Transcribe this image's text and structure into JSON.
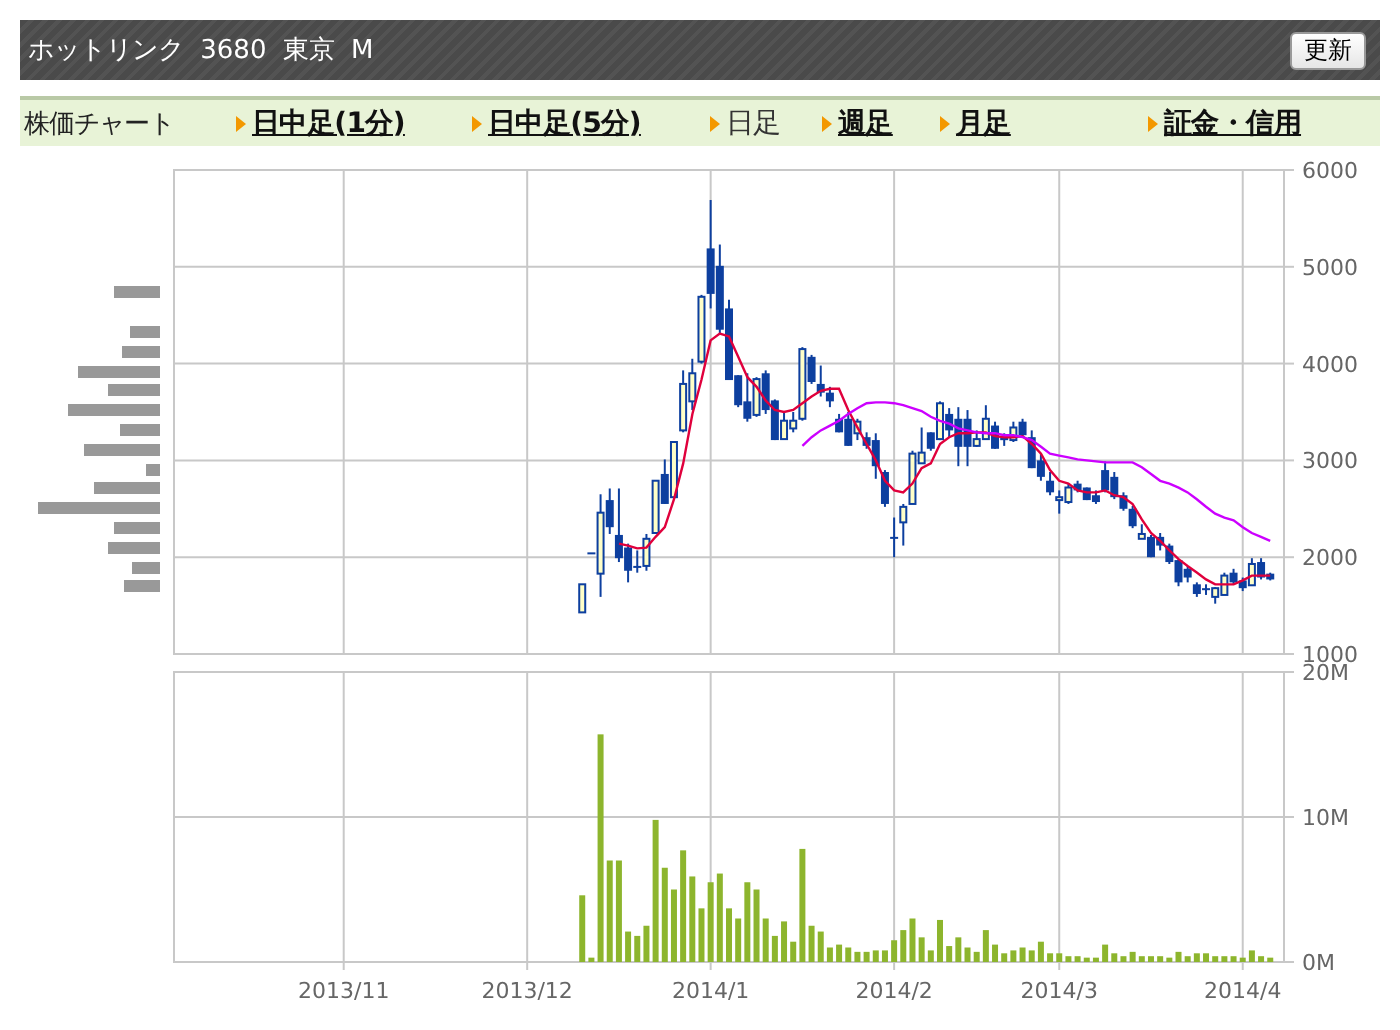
{
  "header": {
    "title": "ホットリンク 3680 東京 M",
    "refresh_button": "更新"
  },
  "nav": {
    "label": "株価チャート",
    "tabs": [
      {
        "label": "日中足(1分)",
        "selected": false
      },
      {
        "label": "日中足(5分)",
        "selected": false
      },
      {
        "label": "日足",
        "selected": true
      },
      {
        "label": "週足",
        "selected": false
      },
      {
        "label": "月足",
        "selected": false
      },
      {
        "label": "証金・信用",
        "selected": false
      }
    ]
  },
  "price_chart": {
    "chart_data": {
      "type": "candlestick",
      "grid": true,
      "ylim": [
        1000,
        6000
      ],
      "yticks": [
        {
          "value": 1000,
          "label": "1000"
        },
        {
          "value": 2000,
          "label": "2000"
        },
        {
          "value": 3000,
          "label": "3000"
        },
        {
          "value": 4000,
          "label": "4000"
        },
        {
          "value": 5000,
          "label": "5000"
        },
        {
          "value": 6000,
          "label": "6000"
        }
      ],
      "ohlc": [
        null,
        null,
        null,
        null,
        null,
        null,
        null,
        null,
        null,
        null,
        null,
        null,
        null,
        null,
        null,
        null,
        null,
        null,
        null,
        null,
        null,
        null,
        null,
        null,
        null,
        null,
        null,
        null,
        null,
        null,
        null,
        null,
        null,
        null,
        null,
        null,
        null,
        null,
        null,
        null,
        null,
        null,
        null,
        null,
        [
          1430,
          1720,
          1430,
          1720
        ],
        [
          2050,
          2050,
          2050,
          2050
        ],
        [
          1830,
          2650,
          1590,
          2460
        ],
        [
          2590,
          2710,
          2240,
          2310
        ],
        [
          2230,
          2710,
          1950,
          1990
        ],
        [
          2100,
          2140,
          1740,
          1860
        ],
        [
          1910,
          2070,
          1840,
          1910
        ],
        [
          1910,
          2240,
          1860,
          2190
        ],
        [
          2250,
          2790,
          2250,
          2790
        ],
        [
          2860,
          3010,
          2550,
          2550
        ],
        [
          2620,
          3190,
          2620,
          3190
        ],
        [
          3310,
          3930,
          3290,
          3790
        ],
        [
          3610,
          4050,
          3520,
          3900
        ],
        [
          4020,
          4710,
          4000,
          4690
        ],
        [
          5190,
          5690,
          4570,
          4720
        ],
        [
          5010,
          5230,
          4310,
          4350
        ],
        [
          4570,
          4660,
          3830,
          3830
        ],
        [
          3880,
          3880,
          3550,
          3570
        ],
        [
          3610,
          3900,
          3400,
          3430
        ],
        [
          3470,
          3860,
          3450,
          3840
        ],
        [
          3900,
          3930,
          3480,
          3520
        ],
        [
          3620,
          3630,
          3210,
          3210
        ],
        [
          3220,
          3500,
          3220,
          3410
        ],
        [
          3330,
          3500,
          3290,
          3410
        ],
        [
          3430,
          4170,
          3410,
          4150
        ],
        [
          4070,
          4090,
          3790,
          3810
        ],
        [
          3790,
          3980,
          3660,
          3700
        ],
        [
          3700,
          3760,
          3550,
          3610
        ],
        [
          3430,
          3480,
          3290,
          3290
        ],
        [
          3430,
          3500,
          3150,
          3150
        ],
        [
          3280,
          3430,
          3210,
          3400
        ],
        [
          3240,
          3290,
          3120,
          3150
        ],
        [
          3210,
          3280,
          2810,
          2940
        ],
        [
          2880,
          2900,
          2520,
          2550
        ],
        [
          2210,
          2410,
          2000,
          2210
        ],
        [
          2360,
          2550,
          2120,
          2520
        ],
        [
          2550,
          3100,
          2550,
          3070
        ],
        [
          2970,
          3340,
          2970,
          3080
        ],
        [
          3290,
          3290,
          3100,
          3120
        ],
        [
          3220,
          3610,
          3210,
          3590
        ],
        [
          3480,
          3540,
          3240,
          3310
        ],
        [
          3430,
          3550,
          2940,
          3140
        ],
        [
          3430,
          3520,
          2940,
          3140
        ],
        [
          3150,
          3310,
          3140,
          3220
        ],
        [
          3220,
          3570,
          3220,
          3430
        ],
        [
          3360,
          3400,
          3120,
          3120
        ],
        [
          3220,
          3280,
          3150,
          3240
        ],
        [
          3210,
          3400,
          3190,
          3340
        ],
        [
          3400,
          3430,
          3240,
          3260
        ],
        [
          3240,
          3310,
          2920,
          2920
        ],
        [
          3000,
          3070,
          2790,
          2830
        ],
        [
          2790,
          2880,
          2640,
          2670
        ],
        [
          2590,
          2690,
          2450,
          2620
        ],
        [
          2570,
          2760,
          2550,
          2720
        ],
        [
          2760,
          2790,
          2670,
          2690
        ],
        [
          2720,
          2720,
          2590,
          2590
        ],
        [
          2640,
          2690,
          2550,
          2570
        ],
        [
          2900,
          2990,
          2670,
          2690
        ],
        [
          2830,
          2880,
          2600,
          2620
        ],
        [
          2640,
          2670,
          2480,
          2500
        ],
        [
          2500,
          2530,
          2300,
          2320
        ],
        [
          2190,
          2340,
          2190,
          2240
        ],
        [
          2210,
          2230,
          2000,
          2000
        ],
        [
          2210,
          2250,
          2070,
          2120
        ],
        [
          2120,
          2140,
          1930,
          1950
        ],
        [
          1970,
          1980,
          1700,
          1740
        ],
        [
          1880,
          1910,
          1740,
          1790
        ],
        [
          1720,
          1740,
          1590,
          1620
        ],
        [
          1680,
          1720,
          1610,
          1680
        ],
        [
          1590,
          1690,
          1520,
          1680
        ],
        [
          1610,
          1840,
          1610,
          1810
        ],
        [
          1840,
          1880,
          1720,
          1740
        ],
        [
          1760,
          1790,
          1650,
          1680
        ],
        [
          1710,
          1990,
          1710,
          1930
        ],
        [
          1950,
          1990,
          1770,
          1790
        ],
        [
          1830,
          1840,
          1760,
          1770
        ],
        null
      ],
      "series": [
        {
          "type": "line",
          "color": "#e0003c",
          "values": [
            null,
            null,
            null,
            null,
            null,
            null,
            null,
            null,
            null,
            null,
            null,
            null,
            null,
            null,
            null,
            null,
            null,
            null,
            null,
            null,
            null,
            null,
            null,
            null,
            null,
            null,
            null,
            null,
            null,
            null,
            null,
            null,
            null,
            null,
            null,
            null,
            null,
            null,
            null,
            null,
            null,
            null,
            null,
            null,
            null,
            null,
            null,
            null,
            2140,
            2120,
            2090,
            2100,
            2210,
            2310,
            2600,
            2970,
            3480,
            3830,
            4240,
            4310,
            4280,
            4070,
            3860,
            3760,
            3620,
            3520,
            3500,
            3520,
            3590,
            3660,
            3720,
            3740,
            3740,
            3520,
            3340,
            3170,
            3000,
            2790,
            2690,
            2670,
            2760,
            2920,
            2970,
            3170,
            3240,
            3280,
            3280,
            3290,
            3290,
            3250,
            3240,
            3240,
            3250,
            3170,
            3070,
            2900,
            2790,
            2760,
            2690,
            2670,
            2670,
            2690,
            2640,
            2620,
            2550,
            2390,
            2250,
            2170,
            2070,
            1980,
            1910,
            1840,
            1770,
            1720,
            1720,
            1720,
            1760,
            1810,
            1810,
            1810,
            null
          ]
        },
        {
          "type": "line",
          "color": "#cc00ff",
          "values": [
            null,
            null,
            null,
            null,
            null,
            null,
            null,
            null,
            null,
            null,
            null,
            null,
            null,
            null,
            null,
            null,
            null,
            null,
            null,
            null,
            null,
            null,
            null,
            null,
            null,
            null,
            null,
            null,
            null,
            null,
            null,
            null,
            null,
            null,
            null,
            null,
            null,
            null,
            null,
            null,
            null,
            null,
            null,
            null,
            null,
            null,
            null,
            null,
            null,
            null,
            null,
            null,
            null,
            null,
            null,
            null,
            null,
            null,
            null,
            null,
            null,
            null,
            null,
            null,
            null,
            null,
            null,
            null,
            3150,
            3240,
            3310,
            3360,
            3410,
            3480,
            3540,
            3590,
            3600,
            3600,
            3590,
            3570,
            3540,
            3510,
            3450,
            3410,
            3380,
            3330,
            3310,
            3290,
            3280,
            3280,
            3260,
            3260,
            3240,
            3210,
            3140,
            3070,
            3050,
            3030,
            3010,
            3000,
            2990,
            2980,
            2980,
            2980,
            2980,
            2930,
            2860,
            2790,
            2760,
            2720,
            2670,
            2600,
            2520,
            2450,
            2410,
            2380,
            2310,
            2250,
            2210,
            2170,
            null
          ]
        }
      ]
    }
  },
  "volume_chart": {
    "chart_data": {
      "type": "bar",
      "grid": true,
      "ylim": [
        0,
        20
      ],
      "categories": [
        null,
        null,
        null,
        null,
        null,
        null,
        null,
        null,
        null,
        null,
        null,
        null,
        null,
        null,
        null,
        null,
        null,
        null,
        "2013/11",
        null,
        null,
        null,
        null,
        null,
        null,
        null,
        null,
        null,
        null,
        null,
        null,
        null,
        null,
        null,
        null,
        null,
        null,
        null,
        "2013/12",
        null,
        null,
        null,
        null,
        null,
        null,
        null,
        null,
        null,
        null,
        null,
        null,
        null,
        null,
        null,
        null,
        null,
        null,
        null,
        "2014/1",
        null,
        null,
        null,
        null,
        null,
        null,
        null,
        null,
        null,
        null,
        null,
        null,
        null,
        null,
        null,
        null,
        null,
        null,
        null,
        "2014/2",
        null,
        null,
        null,
        null,
        null,
        null,
        null,
        null,
        null,
        null,
        null,
        null,
        null,
        null,
        null,
        null,
        null,
        "2014/3",
        null,
        null,
        null,
        null,
        null,
        null,
        null,
        null,
        null,
        null,
        null,
        null,
        null,
        null,
        null,
        null,
        null,
        null,
        null,
        "2014/4",
        null,
        null,
        null,
        null
      ],
      "yticks": [
        {
          "value": 0,
          "label": "0M"
        },
        {
          "value": 10,
          "label": "10M"
        },
        {
          "value": 20,
          "label": "20M"
        }
      ],
      "series": [
        {
          "color": "#8db52d",
          "values": [
            null,
            null,
            null,
            null,
            null,
            null,
            null,
            null,
            null,
            null,
            null,
            null,
            null,
            null,
            null,
            null,
            null,
            null,
            null,
            null,
            null,
            null,
            null,
            null,
            null,
            null,
            null,
            null,
            null,
            null,
            null,
            null,
            null,
            null,
            null,
            null,
            null,
            null,
            null,
            null,
            null,
            null,
            null,
            null,
            4.6,
            0.3,
            15.7,
            7.0,
            7.0,
            2.1,
            1.8,
            2.5,
            9.8,
            6.5,
            5.0,
            7.7,
            5.9,
            3.7,
            5.5,
            6.1,
            3.7,
            3.0,
            5.5,
            5.0,
            3.0,
            1.8,
            2.8,
            1.4,
            7.8,
            2.5,
            2.1,
            1.0,
            1.2,
            1.0,
            0.7,
            0.7,
            0.8,
            0.8,
            1.5,
            2.2,
            3.0,
            1.7,
            0.8,
            2.9,
            1.1,
            1.7,
            1.0,
            0.7,
            2.2,
            1.2,
            0.6,
            0.8,
            1.0,
            0.8,
            1.4,
            0.6,
            0.6,
            0.4,
            0.4,
            0.3,
            0.3,
            1.2,
            0.6,
            0.4,
            0.7,
            0.4,
            0.4,
            0.4,
            0.3,
            0.7,
            0.4,
            0.6,
            0.6,
            0.4,
            0.4,
            0.4,
            0.3,
            0.8,
            0.4,
            0.3,
            null
          ]
        }
      ]
    }
  }
}
